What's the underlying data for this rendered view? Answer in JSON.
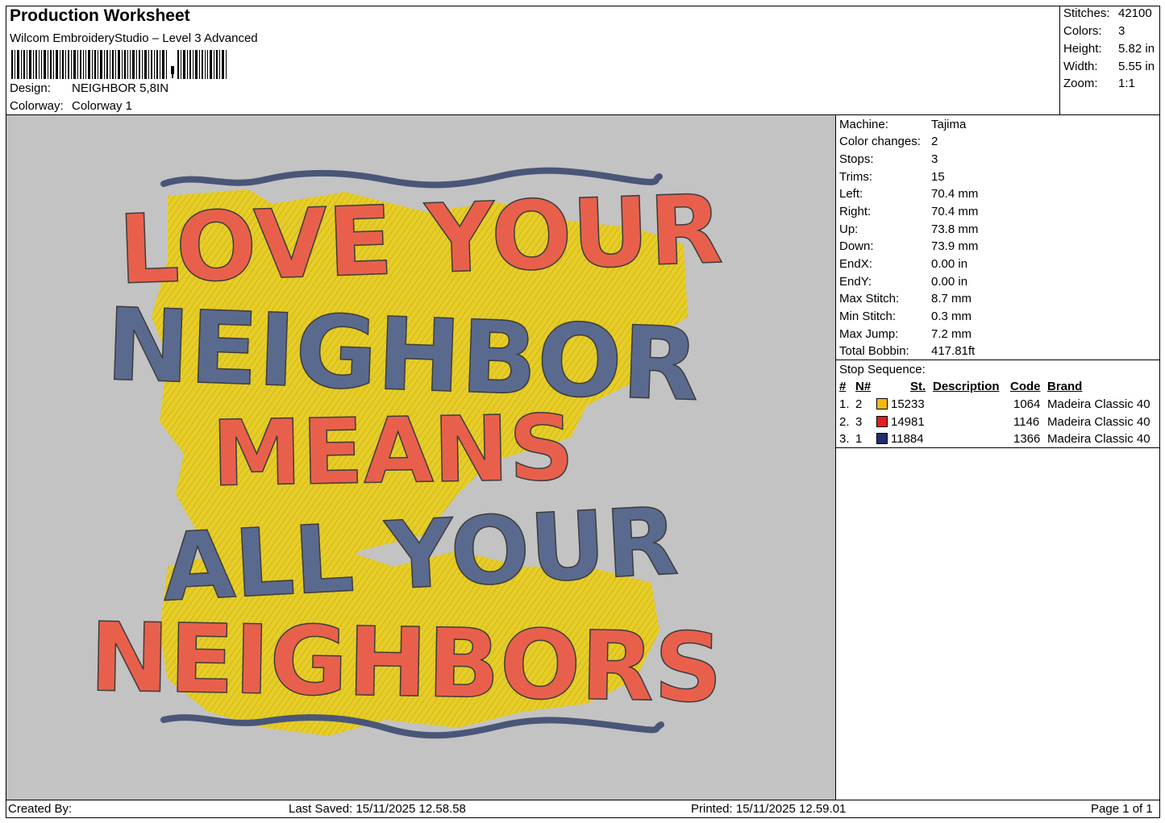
{
  "header": {
    "title": "Production Worksheet",
    "software": "Wilcom EmbroideryStudio – Level 3 Advanced",
    "design_label": "Design:",
    "design_value": "NEIGHBOR 5,8IN",
    "colorway_label": "Colorway:",
    "colorway_value": "Colorway 1"
  },
  "stats": [
    {
      "label": "Stitches:",
      "value": "42100"
    },
    {
      "label": "Colors:",
      "value": "3"
    },
    {
      "label": "Height:",
      "value": "5.82 in"
    },
    {
      "label": "Width:",
      "value": "5.55 in"
    },
    {
      "label": "Zoom:",
      "value": "1:1"
    }
  ],
  "machine_info": [
    {
      "label": "Machine:",
      "value": "Tajima"
    },
    {
      "label": "Color changes:",
      "value": "2"
    },
    {
      "label": "Stops:",
      "value": "3"
    },
    {
      "label": "Trims:",
      "value": "15"
    },
    {
      "label": "Left:",
      "value": "70.4 mm"
    },
    {
      "label": "Right:",
      "value": "70.4 mm"
    },
    {
      "label": "Up:",
      "value": "73.8 mm"
    },
    {
      "label": "Down:",
      "value": "73.9 mm"
    },
    {
      "label": "EndX:",
      "value": "0.00 in"
    },
    {
      "label": "EndY:",
      "value": "0.00 in"
    },
    {
      "label": "Max Stitch:",
      "value": "8.7 mm"
    },
    {
      "label": "Min Stitch:",
      "value": "0.3 mm"
    },
    {
      "label": "Max Jump:",
      "value": "7.2 mm"
    },
    {
      "label": "Total Bobbin:",
      "value": "417.81ft"
    }
  ],
  "stop_sequence": {
    "title": "Stop Sequence:",
    "headers": {
      "num": "#",
      "n": "N#",
      "st": "St.",
      "description": "Description",
      "code": "Code",
      "brand": "Brand"
    },
    "rows": [
      {
        "num": "1.",
        "n": "2",
        "color": "#f5b80f",
        "st": "15233",
        "code": "1064",
        "brand": "Madeira Classic 40"
      },
      {
        "num": "2.",
        "n": "3",
        "color": "#e02020",
        "st": "14981",
        "code": "1146",
        "brand": "Madeira Classic 40"
      },
      {
        "num": "3.",
        "n": "1",
        "color": "#1f2f6b",
        "st": "11884",
        "code": "1366",
        "brand": "Madeira Classic 40"
      }
    ]
  },
  "design": {
    "lines": [
      "LOVE YOUR",
      "NEIGHBOR",
      "MEANS",
      "ALL YOUR",
      "NEIGHBORS"
    ],
    "colors": {
      "yellow": "#e8cf2a",
      "red": "#e8604c",
      "blue": "#5a6a8e",
      "background": "#c3c3c3"
    }
  },
  "footer": {
    "created_by": "Created By:",
    "last_saved": "Last Saved: 15/11/2025 12.58.58",
    "printed": "Printed: 15/11/2025 12.59.01",
    "page": "Page 1 of 1"
  }
}
